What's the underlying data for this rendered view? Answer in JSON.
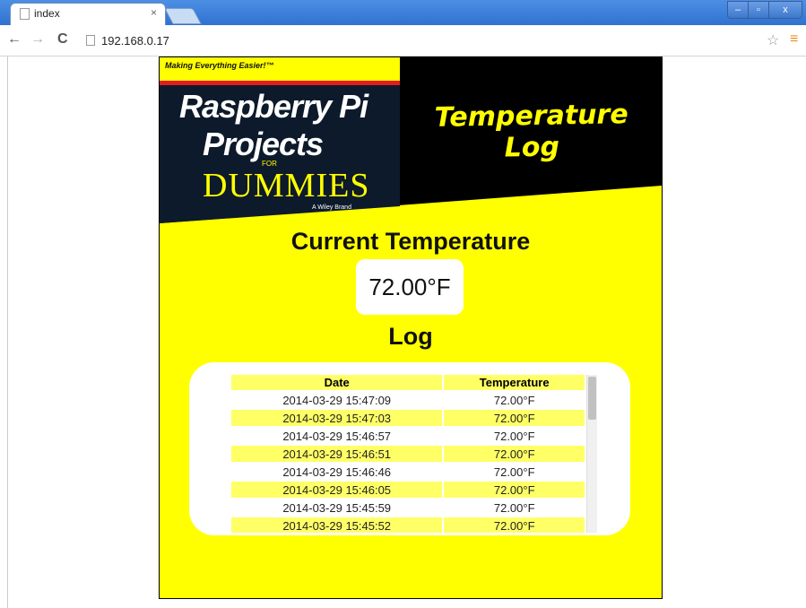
{
  "browser": {
    "tab_title": "index",
    "tab_close": "×",
    "url": "192.168.0.17",
    "window_controls": {
      "minimize": "–",
      "maximize": "▫",
      "close": "x"
    }
  },
  "book_cover": {
    "tagline": "Making Everything Easier!™",
    "title_line1": "Raspberry Pi",
    "title_line2": "Projects",
    "for": "FOR",
    "dummies": "DUMMIES",
    "brand": "A Wiley Brand"
  },
  "header": {
    "title": "Temperature Log"
  },
  "current": {
    "heading": "Current Temperature",
    "value": "72.00°F"
  },
  "log": {
    "heading": "Log",
    "columns": [
      "Date",
      "Temperature"
    ],
    "rows": [
      {
        "date": "2014-03-29 15:47:09",
        "temp": "72.00°F"
      },
      {
        "date": "2014-03-29 15:47:03",
        "temp": "72.00°F"
      },
      {
        "date": "2014-03-29 15:46:57",
        "temp": "72.00°F"
      },
      {
        "date": "2014-03-29 15:46:51",
        "temp": "72.00°F"
      },
      {
        "date": "2014-03-29 15:46:46",
        "temp": "72.00°F"
      },
      {
        "date": "2014-03-29 15:46:05",
        "temp": "72.00°F"
      },
      {
        "date": "2014-03-29 15:45:59",
        "temp": "72.00°F"
      },
      {
        "date": "2014-03-29 15:45:52",
        "temp": "72.00°F"
      }
    ]
  },
  "colors": {
    "page_background": "#ffff00",
    "row_highlight": "#ffff66",
    "header_black": "#000000",
    "title_yellow": "#ffff00"
  }
}
